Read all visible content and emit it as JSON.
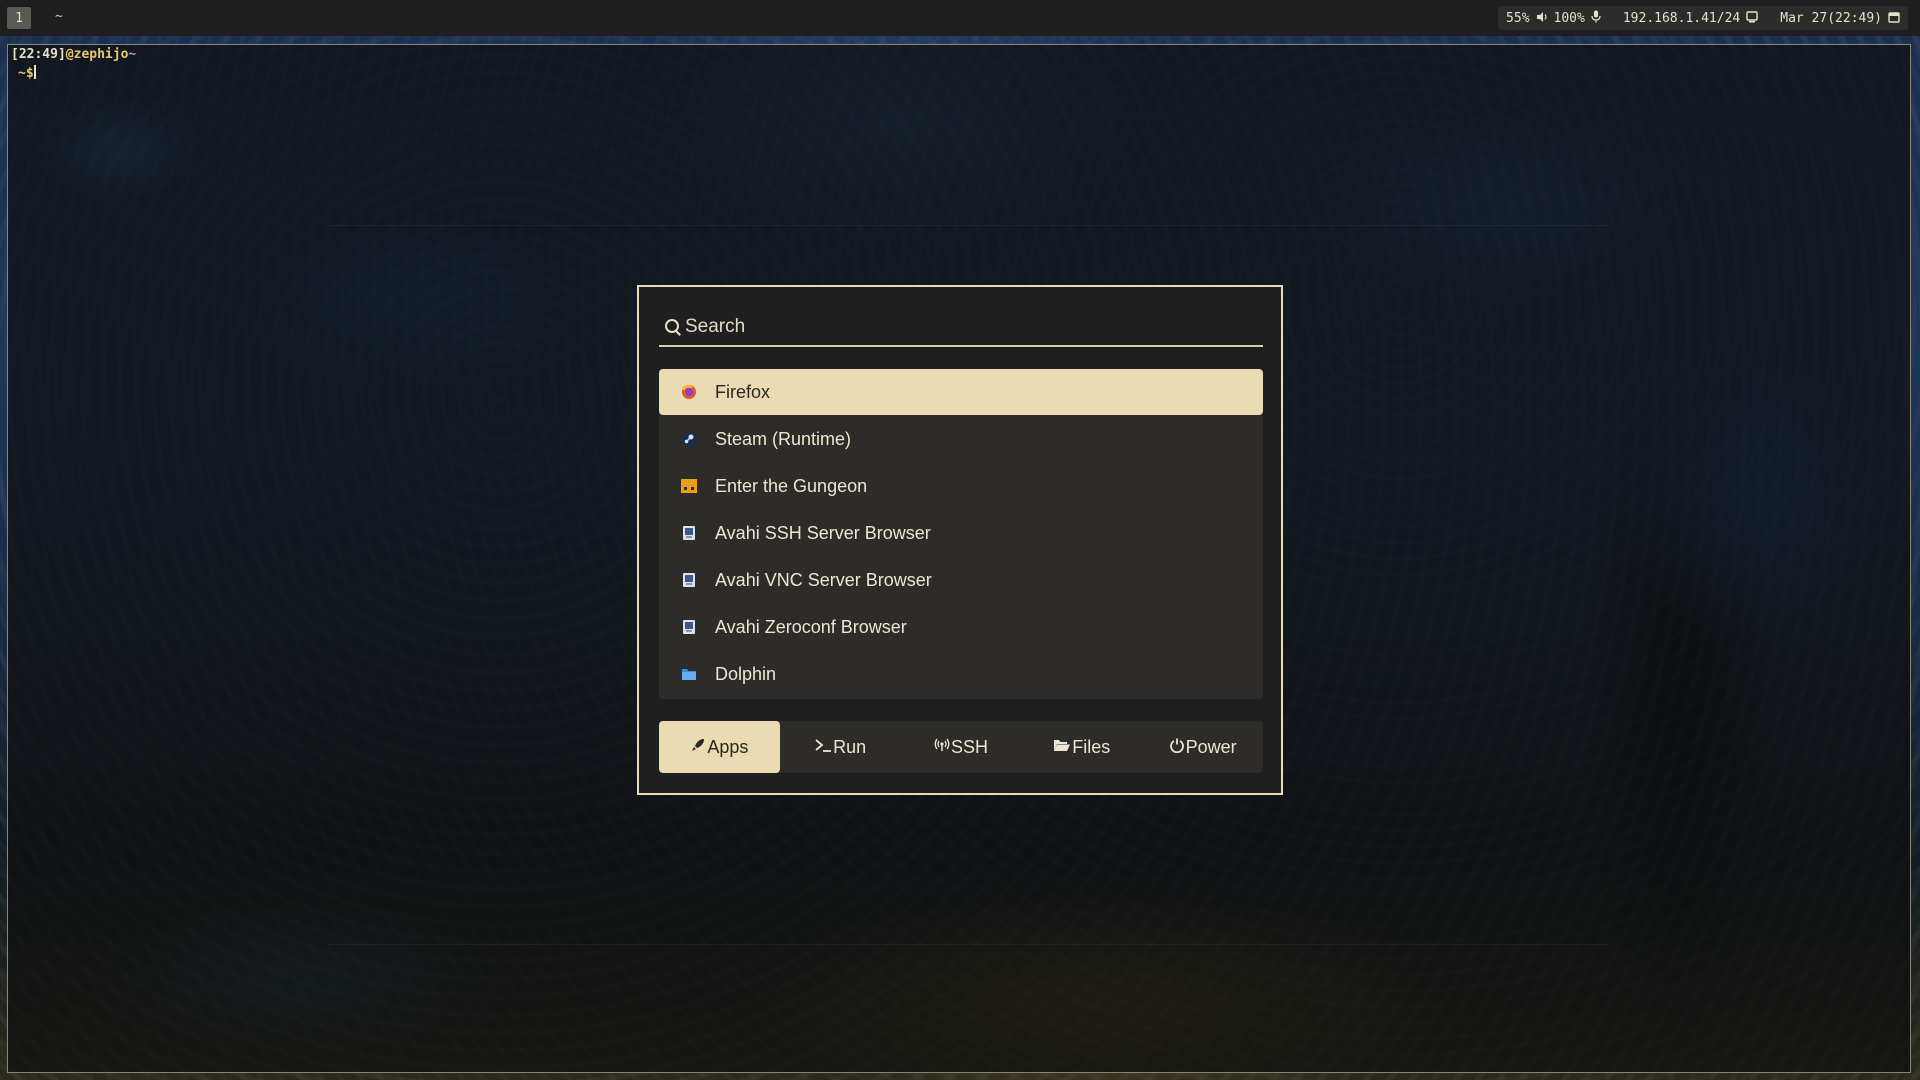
{
  "topbar": {
    "workspace": "1",
    "window_title": "~",
    "status": {
      "brightness": "55%",
      "volume": "100%",
      "ip": "192.168.1.41/24",
      "datetime": "Mar 27(22:49)"
    }
  },
  "terminal": {
    "prompt_time": "[22:49]",
    "prompt_user": "@zephijo",
    "prompt_dir": "~",
    "prompt_line2": "~$"
  },
  "launcher": {
    "search": {
      "placeholder": "Search",
      "value": ""
    },
    "apps": [
      {
        "label": "Firefox",
        "icon": "firefox-icon",
        "selected": true
      },
      {
        "label": "Steam (Runtime)",
        "icon": "steam-icon"
      },
      {
        "label": "Enter the Gungeon",
        "icon": "gungeon-icon"
      },
      {
        "label": "Avahi SSH Server Browser",
        "icon": "avahi-icon"
      },
      {
        "label": "Avahi VNC Server Browser",
        "icon": "avahi-icon"
      },
      {
        "label": "Avahi Zeroconf Browser",
        "icon": "avahi-icon"
      },
      {
        "label": "Dolphin",
        "icon": "folder-icon"
      }
    ],
    "tabs": [
      {
        "label": "Apps",
        "icon": "rocket-icon",
        "active": true
      },
      {
        "label": "Run",
        "icon": "terminal-prompt-icon"
      },
      {
        "label": "SSH",
        "icon": "network-icon"
      },
      {
        "label": "Files",
        "icon": "folder-open-icon"
      },
      {
        "label": "Power",
        "icon": "power-icon"
      }
    ]
  },
  "colors": {
    "accent": "#eadbb3",
    "panel": "#1f1f1f",
    "list_bg": "#2d2c29",
    "text": "#ece6d2"
  }
}
